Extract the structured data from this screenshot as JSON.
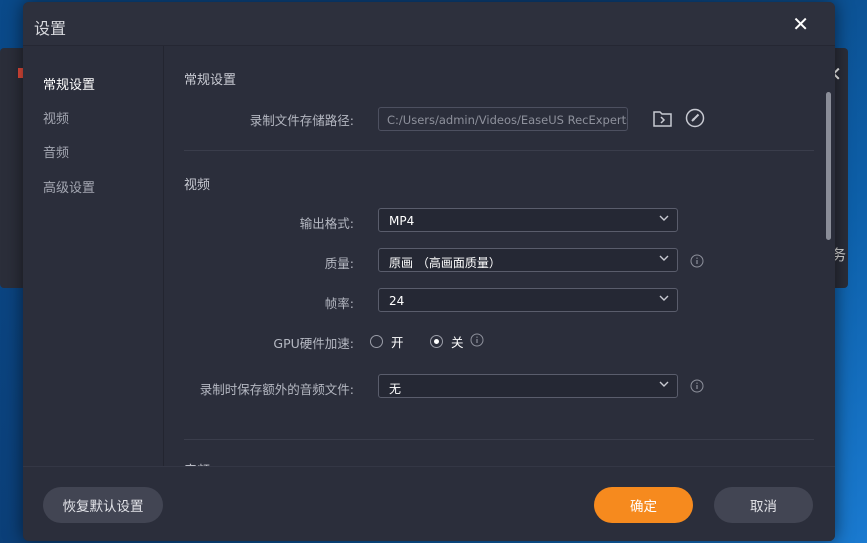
{
  "background_window": {
    "close_glyph": "✕",
    "partial_text": "务"
  },
  "dialog": {
    "title": "设置",
    "close_glyph": "✕",
    "sidebar": {
      "items": [
        {
          "label": "常规设置",
          "active": true
        },
        {
          "label": "视频",
          "active": false
        },
        {
          "label": "音频",
          "active": false
        },
        {
          "label": "高级设置",
          "active": false
        }
      ]
    },
    "general": {
      "section_title": "常规设置",
      "save_path_label": "录制文件存储路径:",
      "save_path_value": "C:/Users/admin/Videos/EaseUS RecExperts",
      "folder_icon": "folder-open-icon",
      "edit_icon": "compass-edit-icon"
    },
    "video": {
      "section_title": "视频",
      "format_label": "输出格式:",
      "format_value": "MP4",
      "quality_label": "质量:",
      "quality_value": "原画 （高画面质量）",
      "framerate_label": "帧率:",
      "framerate_value": "24",
      "gpu_label": "GPU硬件加速:",
      "gpu_on": "开",
      "gpu_off": "关",
      "gpu_selected": "关",
      "extra_audio_label": "录制时保存额外的音频文件:",
      "extra_audio_value": "无"
    },
    "audio": {
      "section_title": "音频"
    },
    "footer": {
      "reset_label": "恢复默认设置",
      "ok_label": "确定",
      "cancel_label": "取消"
    }
  },
  "colors": {
    "dialog_bg": "#2b2e3b",
    "accent_orange": "#f68a1e",
    "button_grey": "#424553"
  }
}
